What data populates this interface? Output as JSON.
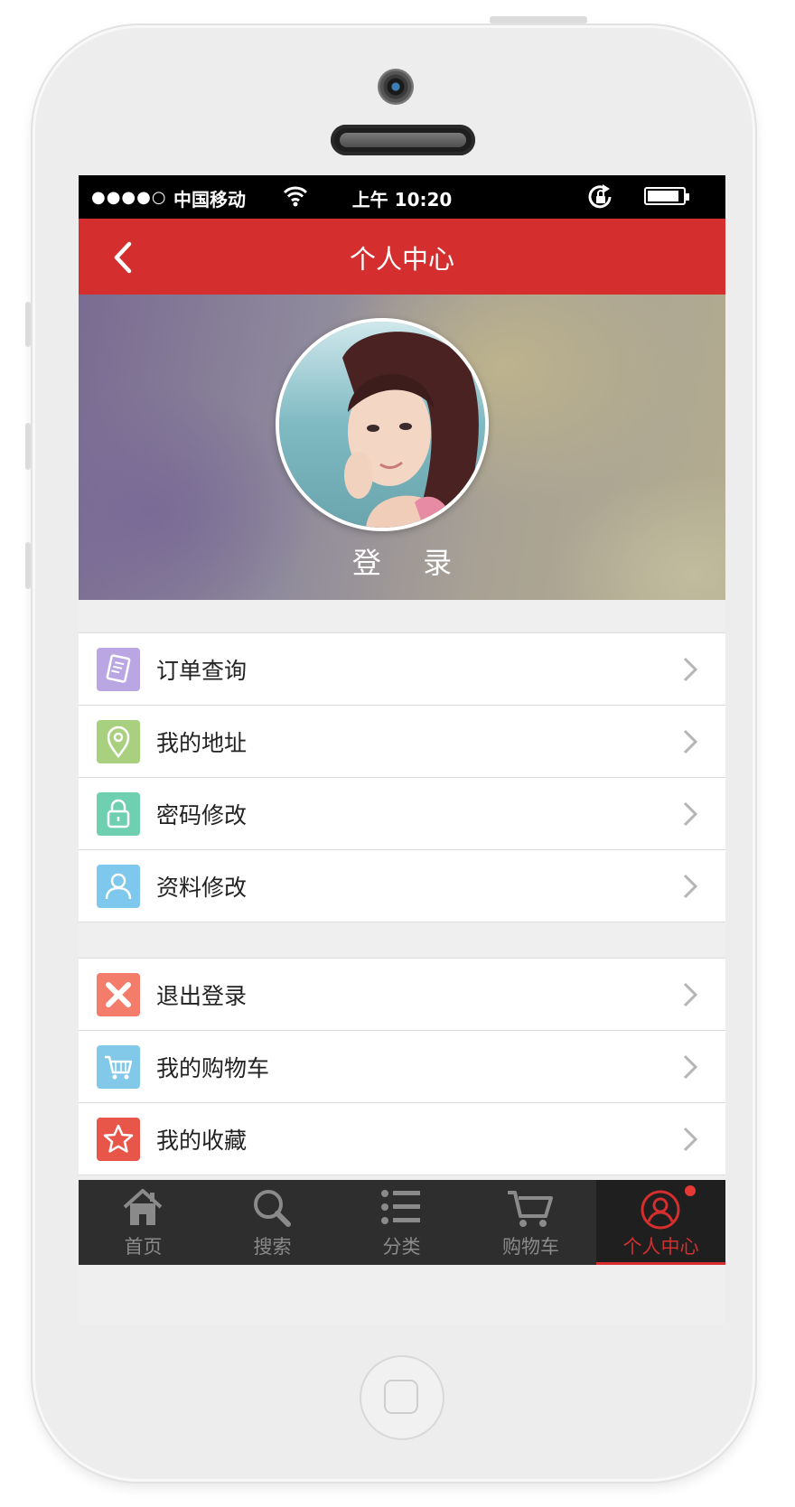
{
  "status_bar": {
    "signal": "●●●●○",
    "carrier": "中国移动",
    "time": "上午 10:20"
  },
  "header": {
    "title": "个人中心"
  },
  "profile": {
    "login_label": "登 录"
  },
  "menu_group_1": [
    {
      "label": "订单查询",
      "icon": "order-list-icon",
      "color": "#b9a6e3"
    },
    {
      "label": "我的地址",
      "icon": "location-pin-icon",
      "color": "#a9d07f"
    },
    {
      "label": "密码修改",
      "icon": "lock-icon",
      "color": "#6fd0b1"
    },
    {
      "label": "资料修改",
      "icon": "user-icon",
      "color": "#7dc8ec"
    }
  ],
  "menu_group_2": [
    {
      "label": "退出登录",
      "icon": "close-icon",
      "color": "#f47c6a"
    },
    {
      "label": "我的购物车",
      "icon": "cart-icon",
      "color": "#82c8e8"
    },
    {
      "label": "我的收藏",
      "icon": "star-icon",
      "color": "#e8564a"
    }
  ],
  "tab_bar": [
    {
      "label": "首页",
      "icon": "home-icon"
    },
    {
      "label": "搜索",
      "icon": "search-icon"
    },
    {
      "label": "分类",
      "icon": "list-icon"
    },
    {
      "label": "购物车",
      "icon": "cart-icon"
    },
    {
      "label": "个人中心",
      "icon": "user-circle-icon",
      "active": true
    }
  ],
  "colors": {
    "accent": "#d42f2e",
    "tab_bar_bg": "#2e2e2e",
    "background": "#efefef"
  }
}
